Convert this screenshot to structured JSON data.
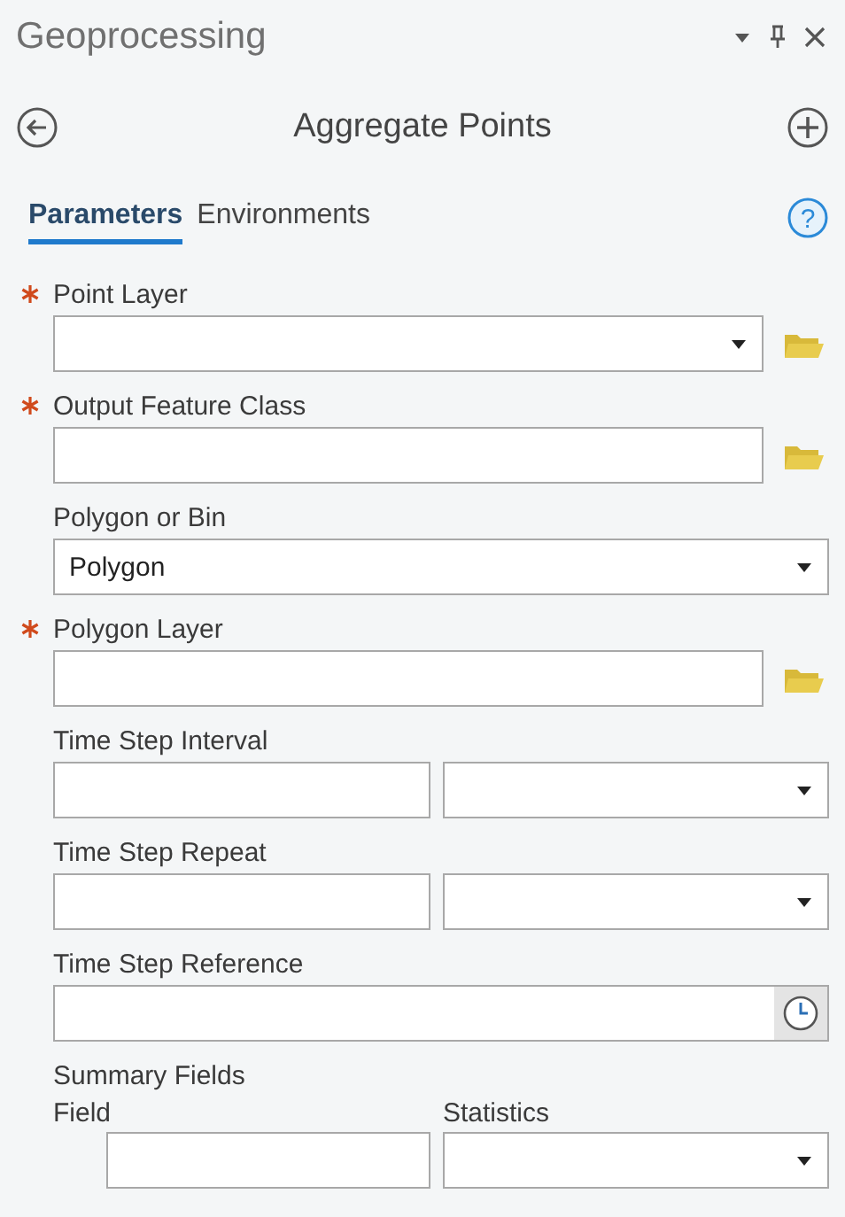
{
  "panel": {
    "title": "Geoprocessing"
  },
  "tool": {
    "title": "Aggregate Points"
  },
  "tabs": [
    {
      "label": "Parameters",
      "selected": true
    },
    {
      "label": "Environments",
      "selected": false
    }
  ],
  "help": {
    "label": "?"
  },
  "parameters": [
    {
      "kind": "combo-browse",
      "label": "Point Layer",
      "required": true
    },
    {
      "kind": "text-browse",
      "label": "Output Feature Class",
      "required": true
    },
    {
      "kind": "combo",
      "label": "Polygon or Bin",
      "required": false,
      "value": "Polygon"
    },
    {
      "kind": "text-browse",
      "label": "Polygon Layer",
      "required": true
    },
    {
      "kind": "pair",
      "label": "Time Step Interval",
      "required": false
    },
    {
      "kind": "pair",
      "label": "Time Step Repeat",
      "required": false
    },
    {
      "kind": "time",
      "label": "Time Step Reference",
      "required": false
    },
    {
      "kind": "summary",
      "label": "Summary Fields",
      "required": false,
      "columns": [
        "Field",
        "Statistics"
      ]
    }
  ]
}
